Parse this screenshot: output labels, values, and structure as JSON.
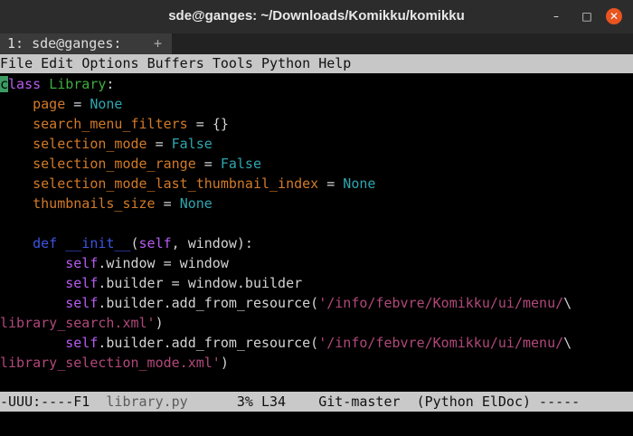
{
  "window": {
    "title": "sde@ganges: ~/Downloads/Komikku/komikku"
  },
  "window_controls": {
    "minimize": "–",
    "maximize": "□",
    "close": "✕"
  },
  "tab": {
    "label": "1: sde@ganges:",
    "add": "+"
  },
  "menu": [
    "File",
    "Edit",
    "Options",
    "Buffers",
    "Tools",
    "Python",
    "Help"
  ],
  "code": {
    "l1_kw_rest": "lass",
    "l1_cursor_char": "c",
    "l1_name": "Library",
    "l1_colon": ":",
    "page": "page",
    "search_menu_filters": "search_menu_filters",
    "selection_mode": "selection_mode",
    "selection_mode_range": "selection_mode_range",
    "selection_mode_last_thumbnail_index": "selection_mode_last_thumbnail_index",
    "thumbnails_size": "thumbnails_size",
    "eq": " = ",
    "none": "None",
    "false": "False",
    "empty_dict": "{}",
    "def": "def",
    "init": "__init__",
    "self": "self",
    "init_args": ", window):",
    "paren_open": "(",
    "l10_rest": ".window = window",
    "l11_rest": ".builder = window.builder",
    "add_from_resource": ".builder.add_from_resource(",
    "path_prefix": "'/info/febvre/Komikku/ui/menu/",
    "backslash": "\\",
    "search_xml": "library_search.xml'",
    "selection_xml": "library_selection_mode.xml'",
    "close_paren": ")"
  },
  "modeline": {
    "status": "-UUU:----F1  ",
    "filename": "library.py",
    "position": "      3% L34    ",
    "vcs": "Git-master",
    "modes": "  (Python ElDoc) -----"
  }
}
